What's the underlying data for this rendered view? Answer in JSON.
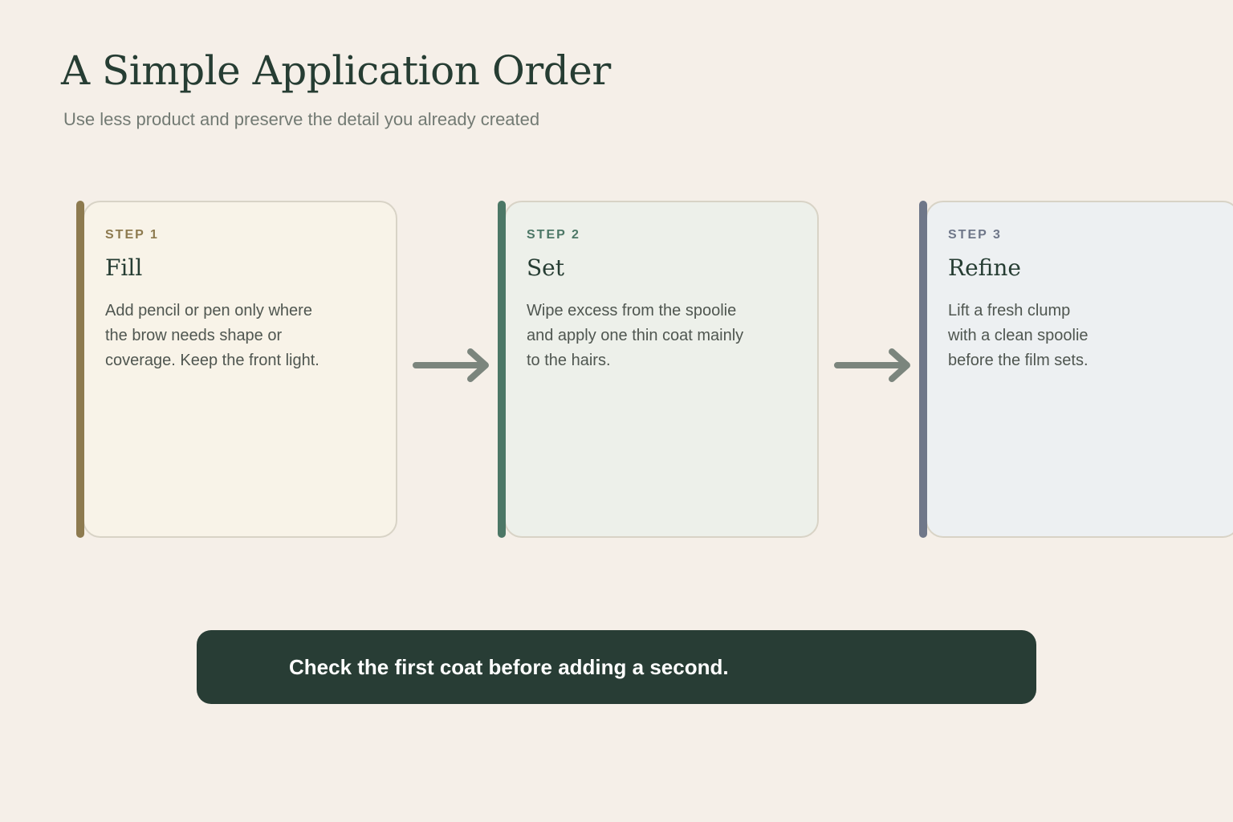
{
  "header": {
    "title": "A Simple Application Order",
    "subtitle": "Use less product and preserve the detail you already created"
  },
  "steps": [
    {
      "label": "STEP 1",
      "title": "Fill",
      "text": "Add pencil or pen only where the brow needs shape or coverage. Keep the front light.",
      "accent_color": "#8d7a4f"
    },
    {
      "label": "STEP 2",
      "title": "Set",
      "text": "Wipe excess from the spoolie and apply one thin coat mainly to the hairs.",
      "accent_color": "#4c7766"
    },
    {
      "label": "STEP 3",
      "title": "Refine",
      "text": "Lift a fresh clump with a clean spoolie before the film sets.",
      "accent_color": "#6f7789"
    }
  ],
  "arrows": [
    {
      "icon": "arrow-right-icon",
      "color": "#7b857d"
    },
    {
      "icon": "arrow-right-icon",
      "color": "#7b857d"
    }
  ],
  "callout": {
    "text": "Check the first coat before adding a second.",
    "background": "#283d35"
  }
}
